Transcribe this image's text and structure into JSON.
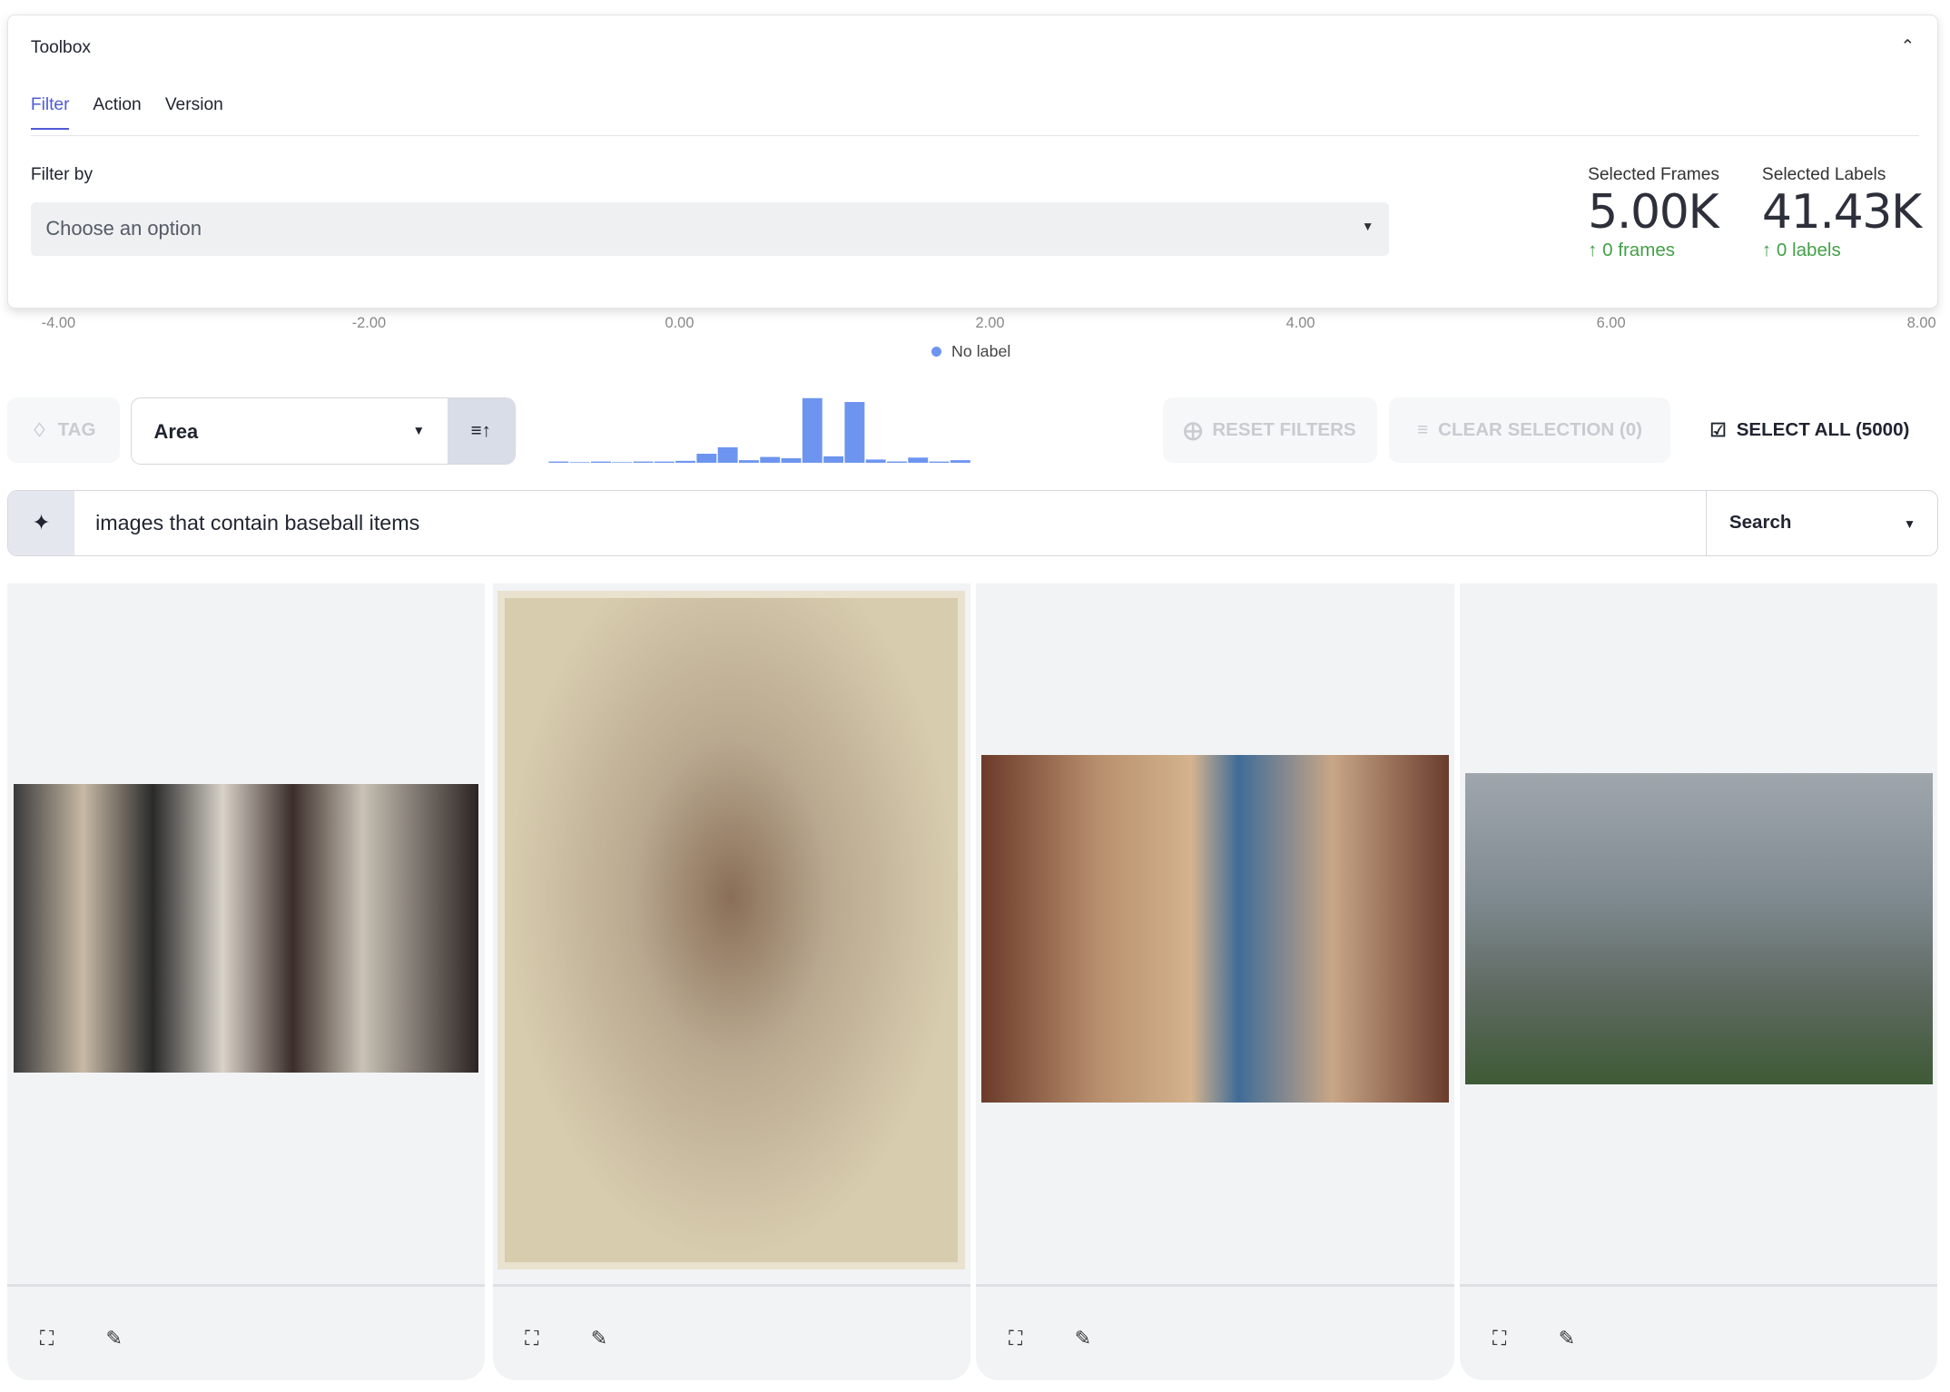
{
  "toolbox": {
    "title": "Toolbox",
    "tabs": [
      {
        "label": "Filter",
        "active": true
      },
      {
        "label": "Action"
      },
      {
        "label": "Version"
      }
    ],
    "filter_label": "Filter by",
    "filter_placeholder": "Choose an option",
    "stats": [
      {
        "label": "Selected Frames",
        "value": "5.00K",
        "delta": "0 frames"
      },
      {
        "label": "Selected Labels",
        "value": "41.43K",
        "delta": "0 labels"
      }
    ]
  },
  "chart_data": [
    {
      "type": "scatter",
      "x_ticks": [
        "-4.00",
        "-2.00",
        "0.00",
        "2.00",
        "4.00",
        "6.00",
        "8.00"
      ],
      "xlim": [
        -4,
        8
      ],
      "legend": [
        {
          "name": "No label",
          "color": "#6d95ef"
        }
      ],
      "legend_placement": "bottom"
    },
    {
      "type": "bar",
      "values": [
        1,
        0,
        1,
        0,
        1,
        1,
        3,
        14,
        24,
        4,
        9,
        7,
        100,
        10,
        94,
        5,
        2,
        8,
        1,
        4
      ],
      "color": "#6d95ef"
    }
  ],
  "toolbar": {
    "tag": "TAG",
    "sort_by": "Area",
    "reset_filters": "RESET FILTERS",
    "clear_selection": "CLEAR SELECTION (0)",
    "select_all": "SELECT ALL (5000)"
  },
  "search": {
    "query": "images that contain baseball items",
    "mode": "Search"
  },
  "colors": {
    "accent": "#4f5bd5",
    "positive": "#43a047",
    "bar": "#6d95ef"
  }
}
